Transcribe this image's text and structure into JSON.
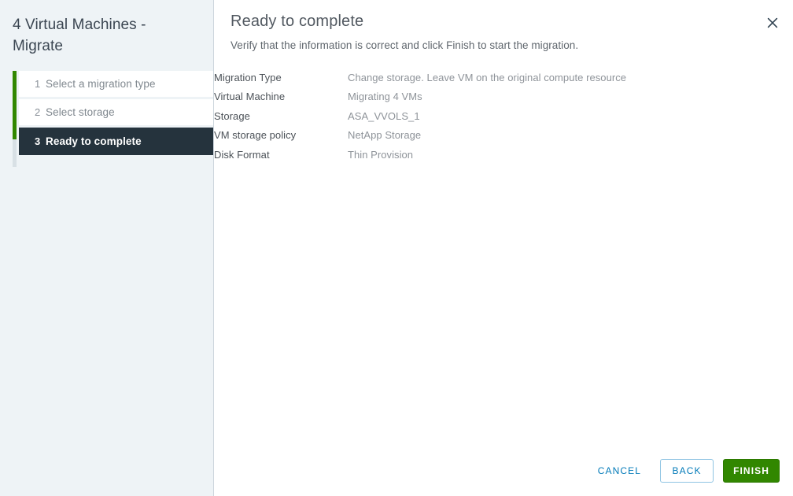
{
  "wizard": {
    "title": "4 Virtual Machines - Migrate",
    "close_icon": "close-icon",
    "steps": [
      {
        "number": "1",
        "label": "Select a migration type",
        "state": "completed"
      },
      {
        "number": "2",
        "label": "Select storage",
        "state": "completed"
      },
      {
        "number": "3",
        "label": "Ready to complete",
        "state": "current"
      }
    ]
  },
  "main": {
    "title": "Ready to complete",
    "subtitle": "Verify that the information is correct and click Finish to start the migration.",
    "summary": [
      {
        "label": "Migration Type",
        "value": "Change storage. Leave VM on the original compute resource"
      },
      {
        "label": "Virtual Machine",
        "value": "Migrating 4 VMs"
      },
      {
        "label": "Storage",
        "value": "ASA_VVOLS_1"
      },
      {
        "label": "VM storage policy",
        "value": "NetApp Storage"
      },
      {
        "label": "Disk Format",
        "value": "Thin Provision"
      }
    ]
  },
  "footer": {
    "cancel_label": "CANCEL",
    "back_label": "BACK",
    "finish_label": "FINISH"
  },
  "colors": {
    "accent_green": "#318700",
    "link_blue": "#0079b8",
    "sidebar_bg": "#eef3f6",
    "current_step_bg": "#25333d"
  }
}
